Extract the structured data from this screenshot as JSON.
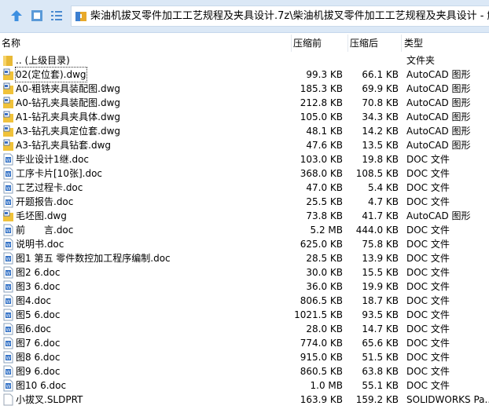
{
  "toolbar": {
    "path": "柴油机拔叉零件加工工艺规程及夹具设计.7z\\柴油机拔叉零件加工工艺规程及夹具设计 - 解包大小"
  },
  "columns": {
    "name": "名称",
    "before": "压缩前",
    "after": "压缩后",
    "type": "类型"
  },
  "rows": [
    {
      "name": ".. (上级目录)",
      "before": "",
      "after": "",
      "type": "文件夹",
      "icon": "folder"
    },
    {
      "name": "02(定位套).dwg",
      "before": "99.3 KB",
      "after": "66.1 KB",
      "type": "AutoCAD 图形",
      "icon": "dwg"
    },
    {
      "name": "A0-粗铣夹具装配图.dwg",
      "before": "185.3 KB",
      "after": "69.9 KB",
      "type": "AutoCAD 图形",
      "icon": "dwg"
    },
    {
      "name": "A0-钻孔夹具装配图.dwg",
      "before": "212.8 KB",
      "after": "70.8 KB",
      "type": "AutoCAD 图形",
      "icon": "dwg"
    },
    {
      "name": "A1-钻孔夹具夹具体.dwg",
      "before": "105.0 KB",
      "after": "34.3 KB",
      "type": "AutoCAD 图形",
      "icon": "dwg"
    },
    {
      "name": "A3-钻孔夹具定位套.dwg",
      "before": "48.1 KB",
      "after": "14.2 KB",
      "type": "AutoCAD 图形",
      "icon": "dwg"
    },
    {
      "name": "A3-钻孔夹具钻套.dwg",
      "before": "47.6 KB",
      "after": "13.5 KB",
      "type": "AutoCAD 图形",
      "icon": "dwg"
    },
    {
      "name": "毕业设计1继.doc",
      "before": "103.0 KB",
      "after": "19.8 KB",
      "type": "DOC 文件",
      "icon": "doc"
    },
    {
      "name": "工序卡片[10张].doc",
      "before": "368.0 KB",
      "after": "108.5 KB",
      "type": "DOC 文件",
      "icon": "doc"
    },
    {
      "name": "工艺过程卡.doc",
      "before": "47.0 KB",
      "after": "5.4 KB",
      "type": "DOC 文件",
      "icon": "doc"
    },
    {
      "name": "开题报告.doc",
      "before": "25.5 KB",
      "after": "4.7 KB",
      "type": "DOC 文件",
      "icon": "doc"
    },
    {
      "name": "毛坯图.dwg",
      "before": "73.8 KB",
      "after": "41.7 KB",
      "type": "AutoCAD 图形",
      "icon": "dwg"
    },
    {
      "name": "前　　言.doc",
      "before": "5.2 MB",
      "after": "444.0 KB",
      "type": "DOC 文件",
      "icon": "doc"
    },
    {
      "name": "说明书.doc",
      "before": "625.0 KB",
      "after": "75.8 KB",
      "type": "DOC 文件",
      "icon": "doc"
    },
    {
      "name": "图1 第五 零件数控加工程序编制.doc",
      "before": "28.5 KB",
      "after": "13.9 KB",
      "type": "DOC 文件",
      "icon": "doc"
    },
    {
      "name": "图2 6.doc",
      "before": "30.0 KB",
      "after": "15.5 KB",
      "type": "DOC 文件",
      "icon": "doc"
    },
    {
      "name": "图3  6.doc",
      "before": "36.0 KB",
      "after": "19.9 KB",
      "type": "DOC 文件",
      "icon": "doc"
    },
    {
      "name": "图4.doc",
      "before": "806.5 KB",
      "after": "18.7 KB",
      "type": "DOC 文件",
      "icon": "doc"
    },
    {
      "name": "图5  6.doc",
      "before": "1021.5 KB",
      "after": "93.5 KB",
      "type": "DOC 文件",
      "icon": "doc"
    },
    {
      "name": "图6.doc",
      "before": "28.0 KB",
      "after": "14.7 KB",
      "type": "DOC 文件",
      "icon": "doc"
    },
    {
      "name": "图7  6.doc",
      "before": "774.0 KB",
      "after": "65.6 KB",
      "type": "DOC 文件",
      "icon": "doc"
    },
    {
      "name": "图8  6.doc",
      "before": "915.0 KB",
      "after": "51.5 KB",
      "type": "DOC 文件",
      "icon": "doc"
    },
    {
      "name": "图9 6.doc",
      "before": "860.5 KB",
      "after": "63.8 KB",
      "type": "DOC 文件",
      "icon": "doc"
    },
    {
      "name": "图10  6.doc",
      "before": "1.0 MB",
      "after": "55.1 KB",
      "type": "DOC 文件",
      "icon": "doc"
    },
    {
      "name": "小拔叉.SLDPRT",
      "before": "163.9 KB",
      "after": "159.2 KB",
      "type": "SOLIDWORKS Pa...",
      "icon": "file"
    }
  ]
}
